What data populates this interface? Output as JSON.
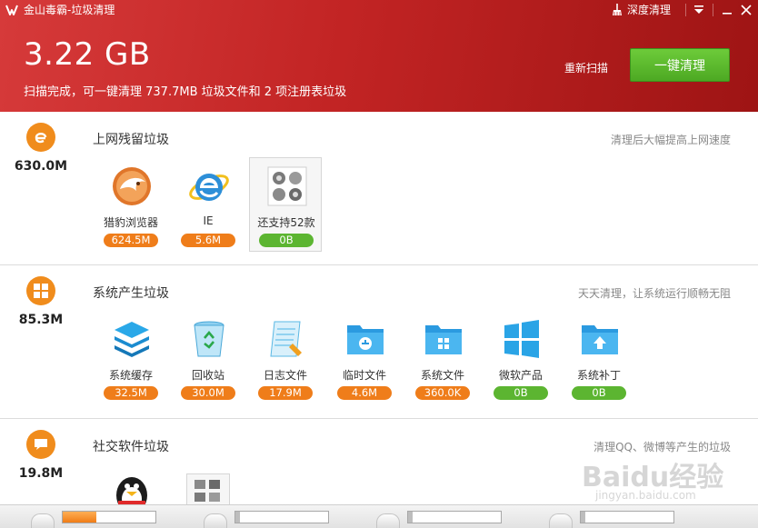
{
  "window": {
    "title": "金山毒霸-垃圾清理",
    "deep_clean_label": "深度清理"
  },
  "header": {
    "total_size": "3.22 GB",
    "status": "扫描完成，可一键清理 737.7MB 垃圾文件和 2 项注册表垃圾",
    "rescan_label": "重新扫描",
    "clean_button_label": "一键清理"
  },
  "sections": [
    {
      "title": "上网残留垃圾",
      "size": "630.0M",
      "tip": "清理后大幅提高上网速度",
      "icon": "ie-e-icon",
      "items": [
        {
          "label": "猎豹浏览器",
          "value": "624.5M",
          "status": "orange",
          "icon": "cheetah-browser-icon"
        },
        {
          "label": "IE",
          "value": "5.6M",
          "status": "orange",
          "icon": "ie-icon"
        },
        {
          "label": "还支持52款",
          "value": "0B",
          "status": "green",
          "icon": "browser-grid-icon"
        }
      ]
    },
    {
      "title": "系统产生垃圾",
      "size": "85.3M",
      "tip": "天天清理，让系统运行顺畅无阻",
      "icon": "windows-icon",
      "items": [
        {
          "label": "系统缓存",
          "value": "32.5M",
          "status": "orange",
          "icon": "layers-icon"
        },
        {
          "label": "回收站",
          "value": "30.0M",
          "status": "orange",
          "icon": "recycle-bin-icon"
        },
        {
          "label": "日志文件",
          "value": "17.9M",
          "status": "orange",
          "icon": "log-file-icon"
        },
        {
          "label": "临时文件",
          "value": "4.6M",
          "status": "orange",
          "icon": "temp-folder-icon"
        },
        {
          "label": "系统文件",
          "value": "360.0K",
          "status": "orange",
          "icon": "system-folder-icon"
        },
        {
          "label": "微软产品",
          "value": "0B",
          "status": "green",
          "icon": "microsoft-icon"
        },
        {
          "label": "系统补丁",
          "value": "0B",
          "status": "green",
          "icon": "patch-folder-icon"
        }
      ]
    },
    {
      "title": "社交软件垃圾",
      "size": "19.8M",
      "tip": "清理QQ、微博等产生的垃圾",
      "icon": "chat-icon",
      "items": [
        {
          "label": "",
          "icon": "qq-penguin-icon"
        },
        {
          "label": "",
          "icon": "social-grid-icon"
        }
      ]
    }
  ],
  "bottom_bar": {
    "progress": [
      0.36,
      0.05,
      0.05,
      0.05
    ]
  },
  "watermark": {
    "text": "Baidu经验",
    "url_text": "jingyan.baidu.com"
  },
  "colors": {
    "header_red": "#c22424",
    "accent_orange": "#f08c1c",
    "badge_orange": "#ef7d1a",
    "badge_green": "#5cb531",
    "button_green": "#5aba2e"
  }
}
